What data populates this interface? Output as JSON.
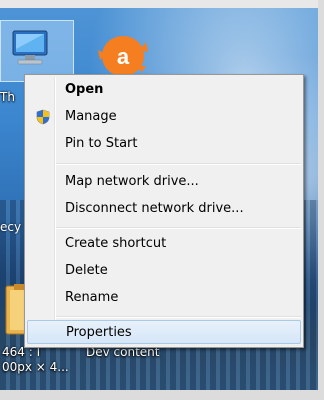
{
  "desktop": {
    "computer_label": "Th",
    "left_fragment": "ecy",
    "file_label_1": "464 : I",
    "file_label_2": "00px × 4...",
    "file_label_3": "Dev content",
    "avast_letter": "a"
  },
  "context_menu": {
    "items": [
      {
        "label": "Open",
        "bold": true
      },
      {
        "label": "Manage",
        "icon": "uac-shield-icon"
      },
      {
        "label": "Pin to Start"
      },
      {
        "label": "Map network drive..."
      },
      {
        "label": "Disconnect network drive..."
      },
      {
        "label": "Create shortcut"
      },
      {
        "label": "Delete"
      },
      {
        "label": "Rename"
      },
      {
        "label": "Properties",
        "selected": true
      }
    ]
  },
  "colors": {
    "menu_background": "#f0f0f0",
    "menu_border": "#979797",
    "selection_fill": "#d5e6f7",
    "selection_border": "#a9c9ea",
    "avast_orange": "#f57e20"
  }
}
